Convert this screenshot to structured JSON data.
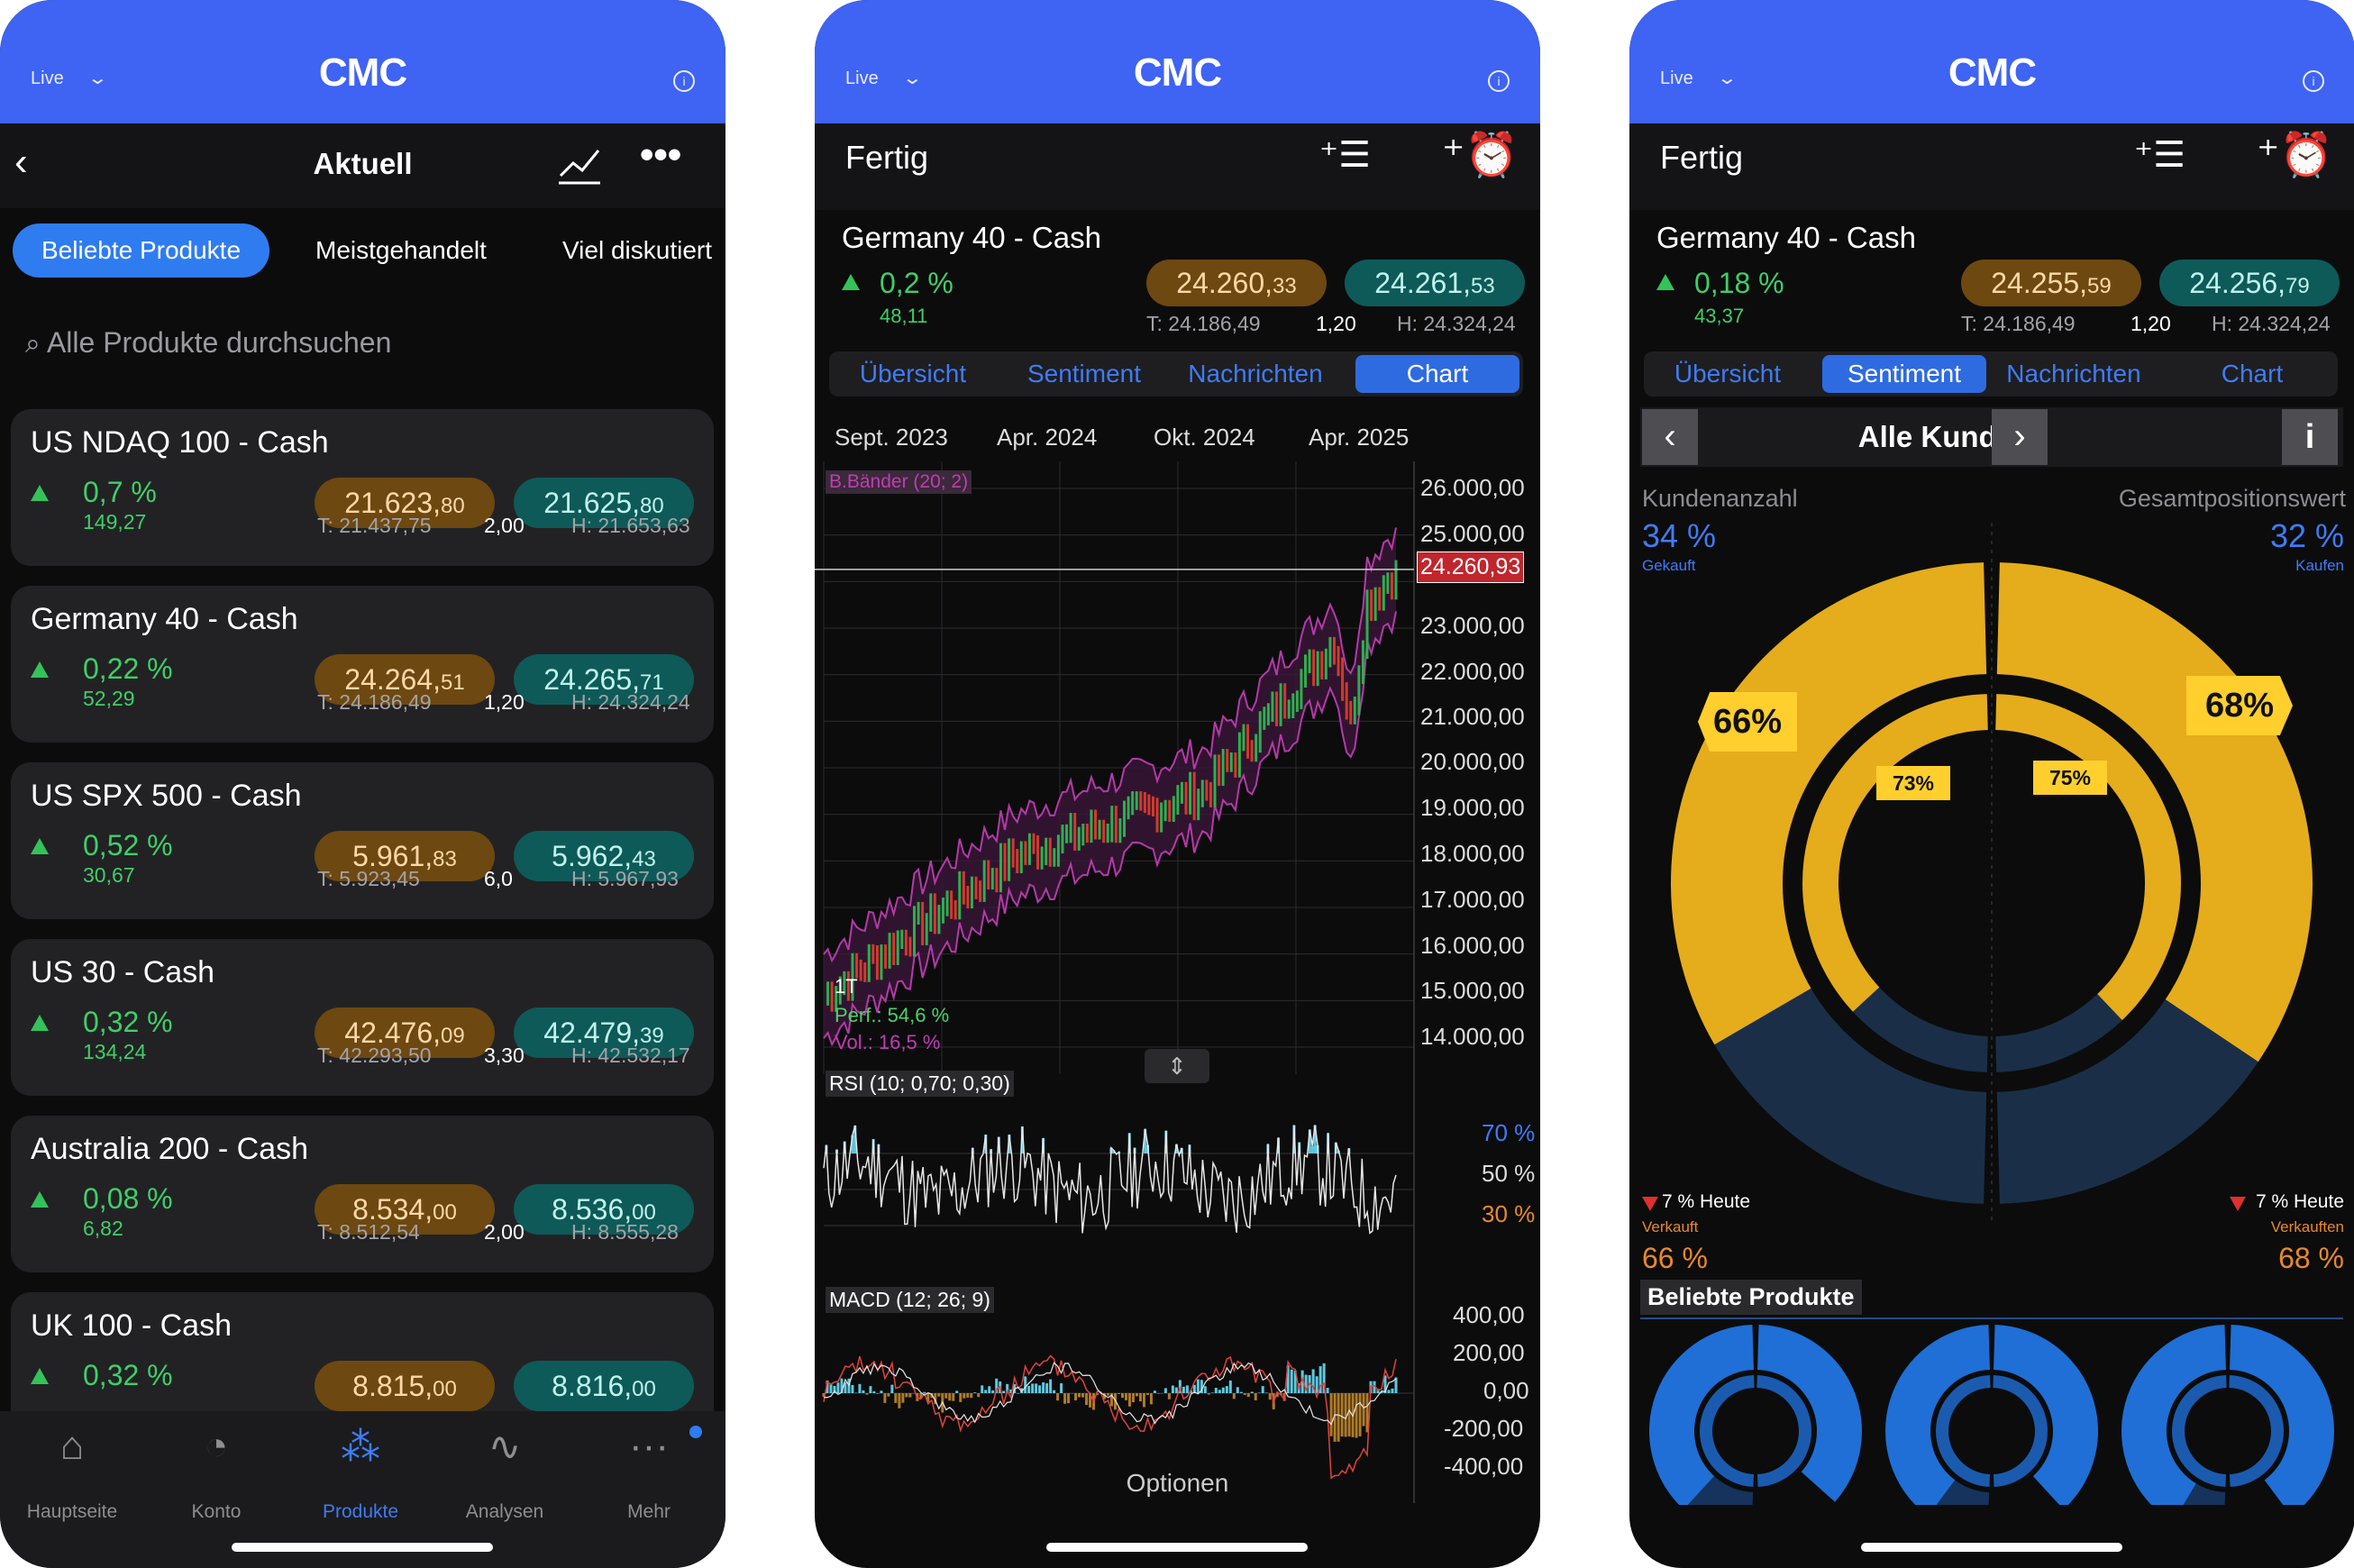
{
  "status": {
    "live": "Live",
    "logo": "CMC"
  },
  "screen1": {
    "title": "Aktuell",
    "tabs": [
      "Beliebte Produkte",
      "Meistgehandelt",
      "Viel diskutiert"
    ],
    "search_placeholder": "Alle Produkte durchsuchen",
    "products": [
      {
        "name": "US NDAQ 100 - Cash",
        "pct": "0,7 %",
        "abs": "149,27",
        "sell_main": "21.623,",
        "sell_small": "80",
        "buy_main": "21.625,",
        "buy_small": "80",
        "low": "T: 21.437,75",
        "spread": "2,00",
        "high": "H: 21.653,63"
      },
      {
        "name": "Germany 40 - Cash",
        "pct": "0,22 %",
        "abs": "52,29",
        "sell_main": "24.264,",
        "sell_small": "51",
        "buy_main": "24.265,",
        "buy_small": "71",
        "low": "T: 24.186,49",
        "spread": "1,20",
        "high": "H: 24.324,24"
      },
      {
        "name": "US SPX 500 - Cash",
        "pct": "0,52 %",
        "abs": "30,67",
        "sell_main": "5.961,",
        "sell_small": "83",
        "buy_main": "5.962,",
        "buy_small": "43",
        "low": "T: 5.923,45",
        "spread": "6,0",
        "high": "H: 5.967,93"
      },
      {
        "name": "US 30 - Cash",
        "pct": "0,32 %",
        "abs": "134,24",
        "sell_main": "42.476,",
        "sell_small": "09",
        "buy_main": "42.479,",
        "buy_small": "39",
        "low": "T: 42.293,50",
        "spread": "3,30",
        "high": "H: 42.532,17"
      },
      {
        "name": "Australia 200 - Cash",
        "pct": "0,08 %",
        "abs": "6,82",
        "sell_main": "8.534,",
        "sell_small": "00",
        "buy_main": "8.536,",
        "buy_small": "00",
        "low": "T: 8.512,54",
        "spread": "2,00",
        "high": "H: 8.555,28"
      },
      {
        "name": "UK 100 - Cash",
        "pct": "0,32 %",
        "abs": "",
        "sell_main": "8.815,",
        "sell_small": "00",
        "buy_main": "8.816,",
        "buy_small": "00",
        "low": "",
        "spread": "",
        "high": ""
      }
    ],
    "tabbar": [
      "Hauptseite",
      "Konto",
      "Produkte",
      "Analysen",
      "Mehr"
    ]
  },
  "screen2": {
    "done": "Fertig",
    "instrument": "Germany 40 - Cash",
    "pct": "0,2 %",
    "abs": "48,11",
    "sell_main": "24.260,",
    "sell_small": "33",
    "buy_main": "24.261,",
    "buy_small": "53",
    "low": "T: 24.186,49",
    "spread": "1,20",
    "high": "H: 24.324,24",
    "subtabs": [
      "Übersicht",
      "Sentiment",
      "Nachrichten",
      "Chart"
    ],
    "time_labels": [
      "Sept. 2023",
      "Apr. 2024",
      "Okt. 2024",
      "Apr. 2025"
    ],
    "bb_label": "B.Bänder (20; 2)",
    "price_ticks": [
      "26.000,00",
      "25.000,00",
      "23.000,00",
      "22.000,00",
      "21.000,00",
      "20.000,00",
      "19.000,00",
      "18.000,00",
      "17.000,00",
      "16.000,00",
      "15.000,00",
      "14.000,00"
    ],
    "current_price": "24.260,93",
    "period": "1T",
    "perf": "Perf.: 54,6 %",
    "vol": "Vol.: 16,5 %",
    "rsi_label": "RSI (10; 0,70; 0,30)",
    "rsi_ticks": [
      "70 %",
      "50 %",
      "30 %"
    ],
    "macd_label": "MACD (12; 26; 9)",
    "macd_ticks": [
      "400,00",
      "200,00",
      "0,00",
      "-200,00",
      "-400,00"
    ],
    "options": "Optionen",
    "chart_data": {
      "type": "line",
      "title": "",
      "x": [
        "Sept. 2023",
        "Apr. 2024",
        "Okt. 2024",
        "Apr. 2025"
      ],
      "series": [
        {
          "values": [
            15100,
            18100,
            19500,
            24260
          ]
        }
      ],
      "ylim": [
        14000,
        26000
      ],
      "grid": true
    }
  },
  "screen3": {
    "done": "Fertig",
    "instrument": "Germany 40 - Cash",
    "pct": "0,18 %",
    "abs": "43,37",
    "sell_main": "24.255,",
    "sell_small": "59",
    "buy_main": "24.256,",
    "buy_small": "79",
    "low": "T: 24.186,49",
    "spread": "1,20",
    "high": "H: 24.324,24",
    "subtabs": [
      "Übersicht",
      "Sentiment",
      "Nachrichten",
      "Chart"
    ],
    "nav_title": "Alle Kunden",
    "left_label": "Kundenanzahl",
    "left_pct": "34 %",
    "left_sub": "Gekauft",
    "right_label": "Gesamtpositionswert",
    "right_pct": "32 %",
    "right_sub": "Kaufen",
    "outer_left": "66%",
    "inner_left": "73%",
    "outer_right": "68%",
    "inner_right": "75%",
    "left_today": "7 % Heute",
    "left_sold": "Verkauft",
    "left_sold_pct": "66 %",
    "right_today": "7 % Heute",
    "right_sold": "Verkauften",
    "right_sold_pct": "68 %",
    "popular": "Beliebte Produkte",
    "colors": {
      "gold": "#e5ac1c",
      "navy": "#1a2f47"
    }
  }
}
